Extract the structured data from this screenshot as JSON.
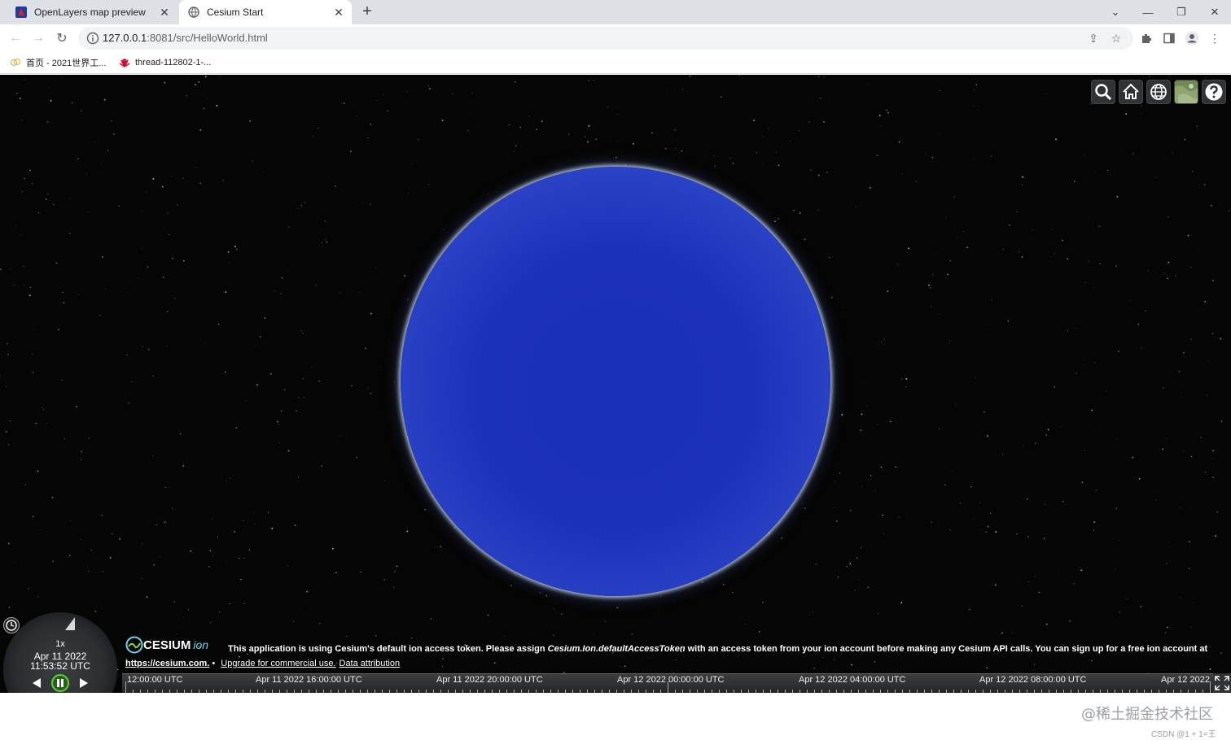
{
  "browser": {
    "tabs": [
      {
        "title": "OpenLayers map preview",
        "active": false,
        "icon": "openlayers-icon"
      },
      {
        "title": "Cesium Start",
        "active": true,
        "icon": "globe-icon"
      }
    ],
    "new_tab": "+",
    "url_host": "127.0.0.1",
    "url_path": ":8081/src/HelloWorld.html",
    "bookmarks": [
      {
        "label": "首页 - 2021世界工...",
        "icon": "bookmark-site-icon"
      },
      {
        "label": "thread-112802-1-...",
        "icon": "huawei-icon"
      }
    ]
  },
  "cesium": {
    "toolbar_buttons": [
      "search-icon",
      "home-icon",
      "globe-icon",
      "imagery-layer-icon",
      "help-icon"
    ],
    "animation": {
      "speed": "1x",
      "date": "Apr 11 2022",
      "time": "11:53:52 UTC"
    },
    "credits": {
      "logo_text": "CESIUM",
      "logo_suffix": "ion",
      "message_part1": "This application is using Cesium's default ion access token. Please assign ",
      "message_code": "Cesium.Ion.defaultAccessToken",
      "message_part2": " with an access token from your ion account before making any Cesium API calls. You can sign up for a free ion account at",
      "link": "https://cesium.com.",
      "separator": " • ",
      "upgrade": "Upgrade for commercial use.",
      "attribution": "Data attribution"
    },
    "timeline_labels": [
      "12:00:00 UTC",
      "Apr 11 2022 16:00:00 UTC",
      "Apr 11 2022 20:00:00 UTC",
      "Apr 12 2022 00:00:00 UTC",
      "Apr 12 2022 04:00:00 UTC",
      "Apr 12 2022 08:00:00 UTC",
      "Apr 12 2022"
    ]
  },
  "watermark": {
    "text": "@稀土掘金技术社区",
    "sub": "CSDN @1 + 1=王"
  }
}
